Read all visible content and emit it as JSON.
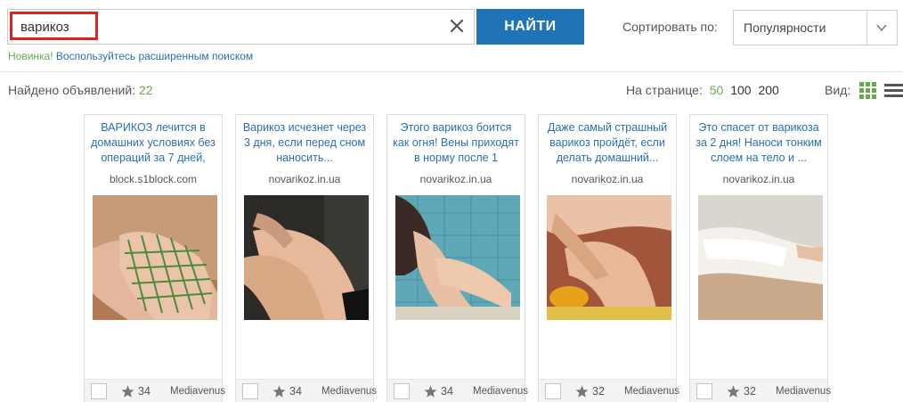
{
  "search": {
    "value": "варикоз",
    "button_label": "НАЙТИ"
  },
  "advanced": {
    "new_label": "Новинка!",
    "link_label": "Воспользуйтесь расширенным поиском"
  },
  "sort": {
    "label": "Сортировать по:",
    "selected": "Популярности"
  },
  "results": {
    "found_label": "Найдено объявлений:",
    "found_count": "22"
  },
  "per_page": {
    "label": "На странице:",
    "options": [
      "50",
      "100",
      "200"
    ],
    "active": "50"
  },
  "view": {
    "label": "Вид:"
  },
  "cards": [
    {
      "title": "ВАРИКОЗ лечится в домашних условиях без операций за 7 дней,",
      "domain": "block.s1block.com",
      "rating": "34",
      "author": "Mediavenus"
    },
    {
      "title": "Варикоз исчезнет через 3 дня, если перед сном наносить...",
      "domain": "novarikoz.in.ua",
      "rating": "34",
      "author": "Mediavenus"
    },
    {
      "title": "Этого варикоз боится как огня! Вены приходят в норму после 1",
      "domain": "novarikoz.in.ua",
      "rating": "34",
      "author": "Mediavenus"
    },
    {
      "title": "Даже самый страшный варикоз пройдёт, если делать домашний...",
      "domain": "novarikoz.in.ua",
      "rating": "32",
      "author": "Mediavenus"
    },
    {
      "title": "Это спасет от варикоза за 2 дня! Наноси тонким слоем на тело и ...",
      "domain": "novarikoz.in.ua",
      "rating": "32",
      "author": "Mediavenus"
    }
  ],
  "colors": {
    "accent_blue": "#1f73b7",
    "accent_green": "#6aa84f",
    "highlight_red": "#e2211c"
  }
}
